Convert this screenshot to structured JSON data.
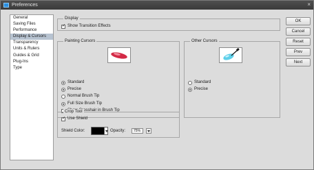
{
  "window": {
    "title": "Preferences"
  },
  "sidebar": {
    "items": [
      {
        "label": "General",
        "selected": false
      },
      {
        "label": "Saving Files",
        "selected": false
      },
      {
        "label": "Performance",
        "selected": false
      },
      {
        "label": "Display & Cursors",
        "selected": true
      },
      {
        "label": "Transparency",
        "selected": false
      },
      {
        "label": "Units & Rulers",
        "selected": false
      },
      {
        "label": "Guides & Grid",
        "selected": false
      },
      {
        "label": "Plug-Ins",
        "selected": false
      },
      {
        "label": "Type",
        "selected": false
      }
    ]
  },
  "display": {
    "legend": "Display",
    "show_transition_effects": {
      "label": "Show Transition Effects",
      "checked": true
    }
  },
  "painting": {
    "legend": "Painting Cursors",
    "options": [
      {
        "label": "Standard",
        "checked": true
      },
      {
        "label": "Precise",
        "checked": true
      },
      {
        "label": "Normal Brush Tip",
        "checked": false
      },
      {
        "label": "Full Size Brush Tip",
        "checked": true
      }
    ],
    "show_crosshair": {
      "label": "Show Crosshair in Brush Tip",
      "checked": false
    }
  },
  "other": {
    "legend": "Other Cursors",
    "options": [
      {
        "label": "Standard",
        "checked": false
      },
      {
        "label": "Precise",
        "checked": true
      }
    ]
  },
  "crop": {
    "legend": "Crop Tool",
    "use_shield": {
      "label": "Use Shield",
      "checked": true
    },
    "shield_color_label": "Shield Color:",
    "shield_color": "#000000",
    "opacity_label": "Opacity:",
    "opacity_value": "75%"
  },
  "buttons": {
    "ok": "OK",
    "cancel": "Cancel",
    "reset": "Reset",
    "prev": "Prev",
    "next": "Next"
  }
}
